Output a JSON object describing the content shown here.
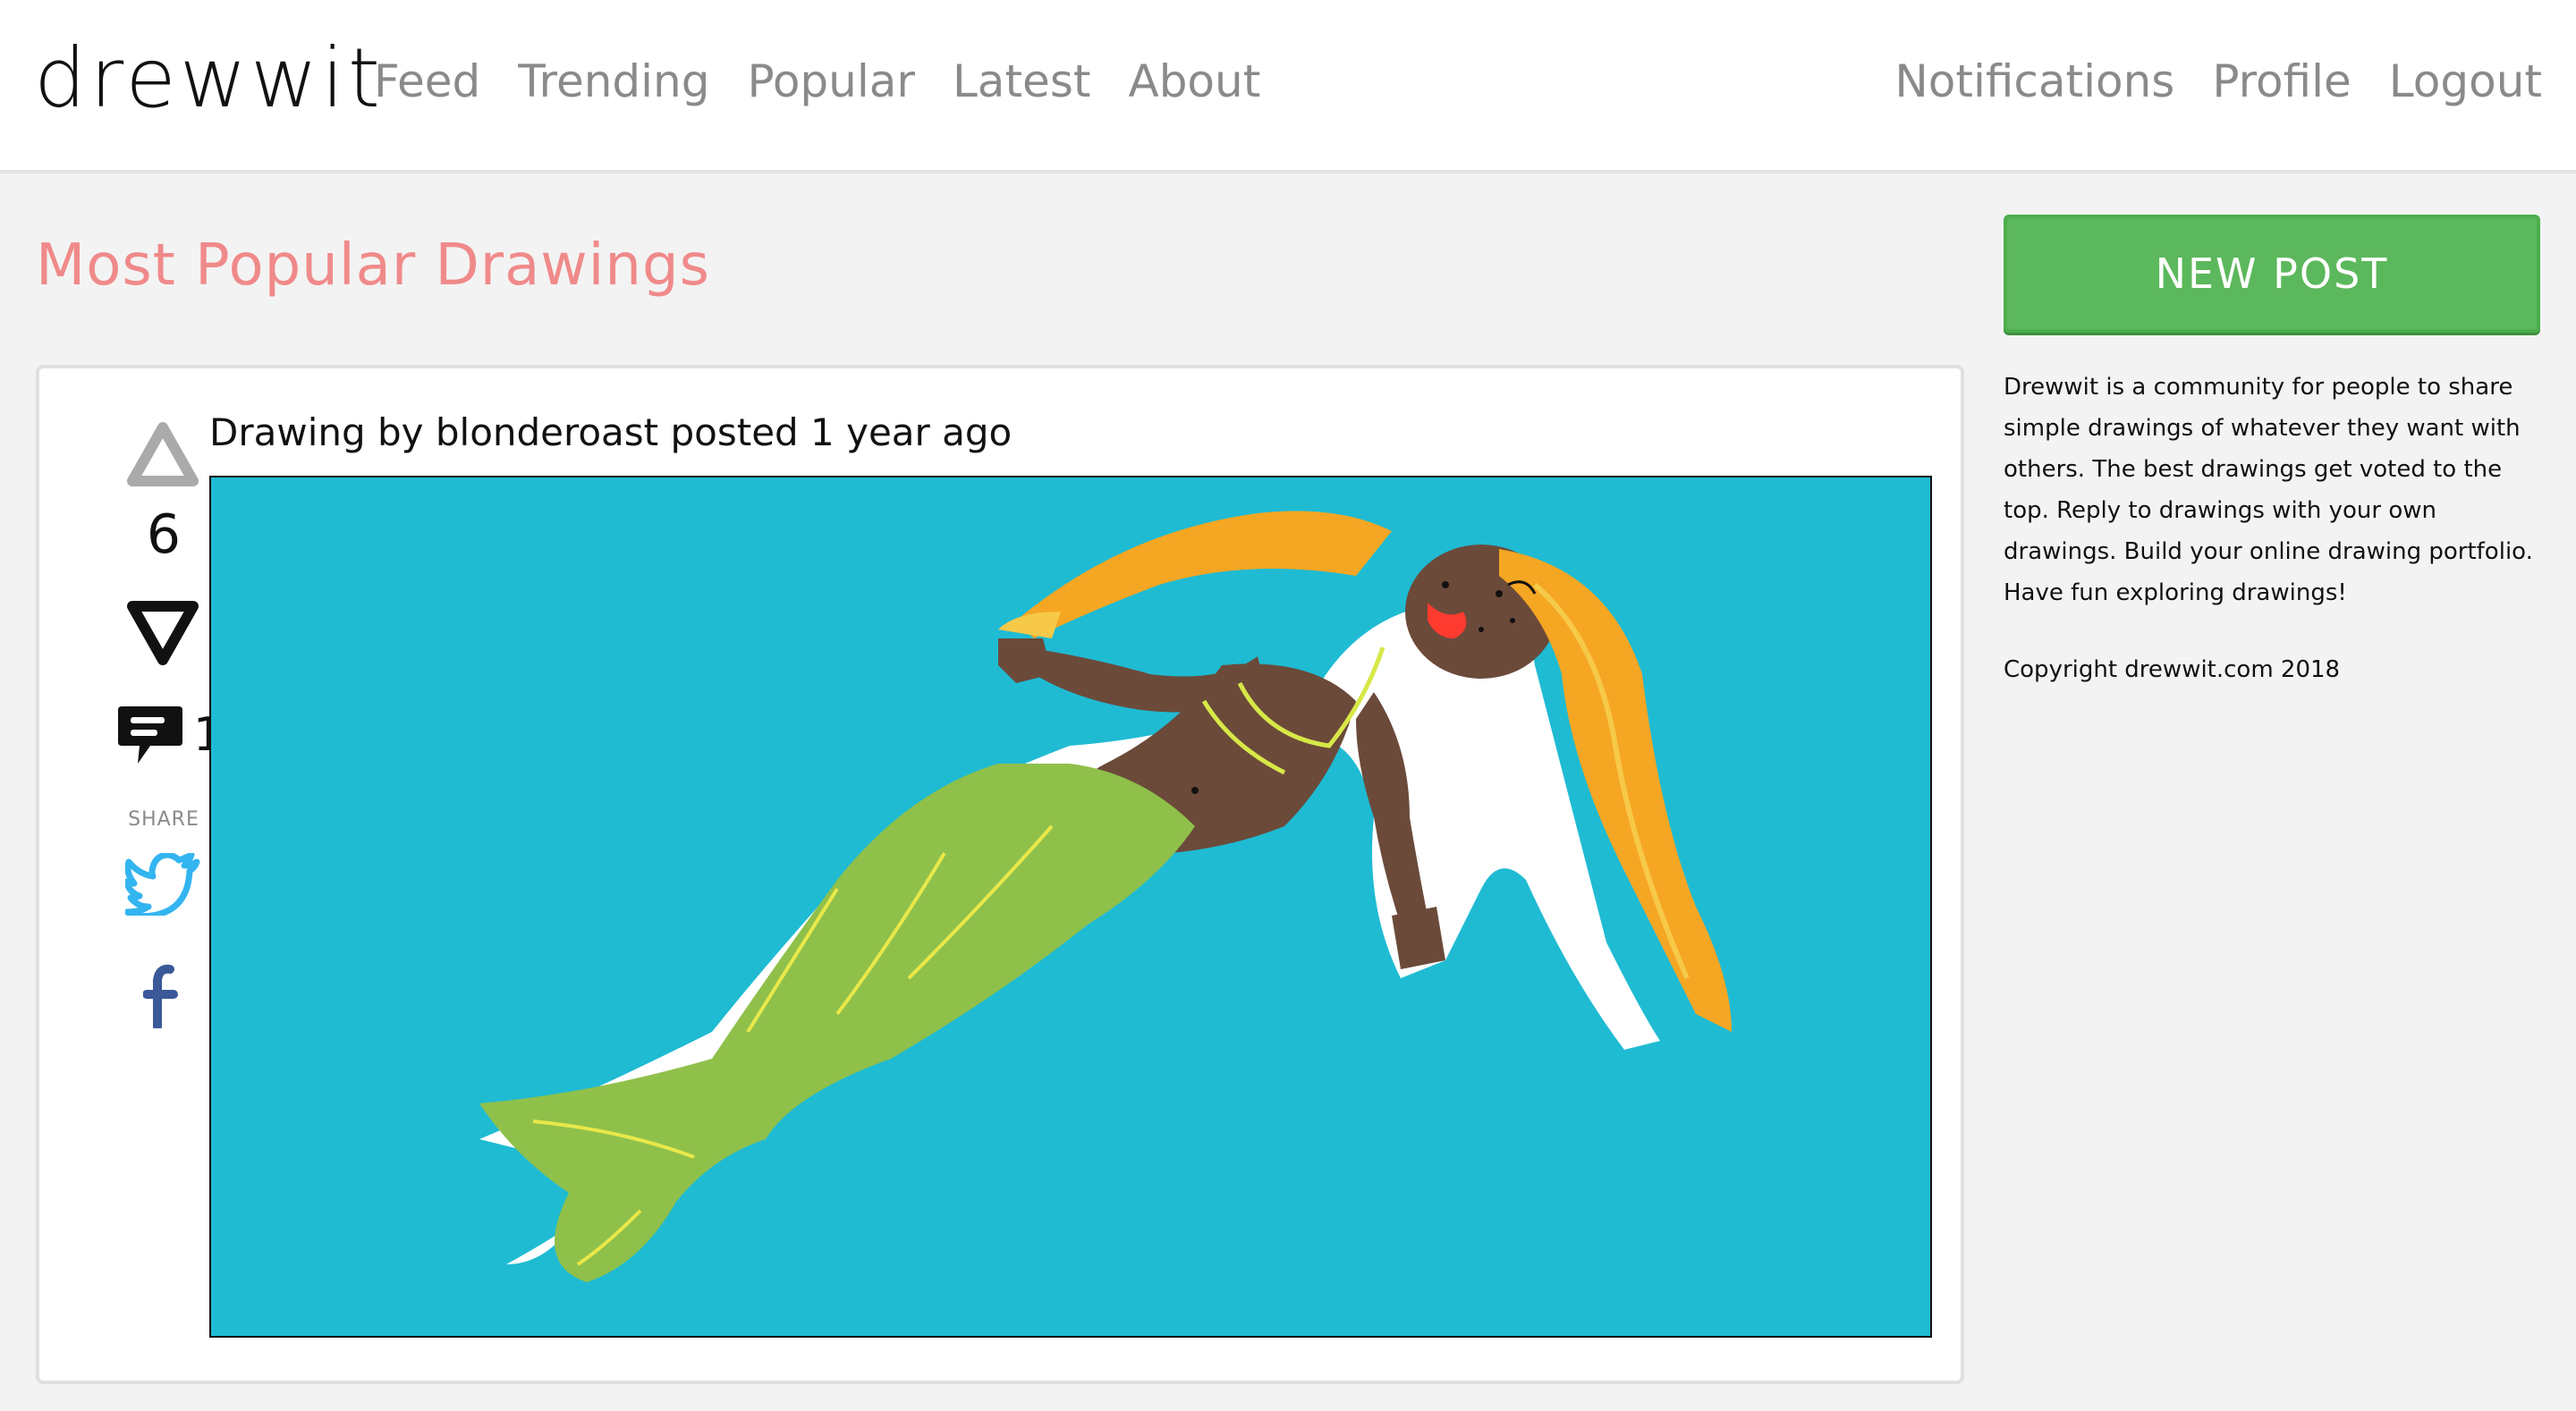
{
  "header": {
    "logo": "drewwit",
    "nav_left": [
      "Feed",
      "Trending",
      "Popular",
      "Latest",
      "About"
    ],
    "nav_right": [
      "Notifications",
      "Profile",
      "Logout"
    ]
  },
  "page": {
    "title": "Most Popular Drawings"
  },
  "post": {
    "meta": "Drawing by blonderoast posted 1 year ago",
    "score": "6",
    "comment_count": "1",
    "share_label": "SHARE"
  },
  "sidebar": {
    "new_post_label": "NEW POST",
    "about": "Drewwit is a community for people to share simple drawings of whatever they want with others. The best drawings get voted to the top. Reply to drawings with your own drawings. Build your online drawing portfolio. Have fun exploring drawings!",
    "copyright": "Copyright drewwit.com 2018"
  },
  "colors": {
    "title_pink": "#f08a8a",
    "button_green": "#5cb85c",
    "canvas_blue": "#1fbbd3",
    "twitter_blue": "#1da1f2",
    "facebook_blue": "#3b5998"
  },
  "icons": [
    "upvote-icon",
    "downvote-icon",
    "comment-icon",
    "twitter-icon",
    "facebook-icon"
  ]
}
